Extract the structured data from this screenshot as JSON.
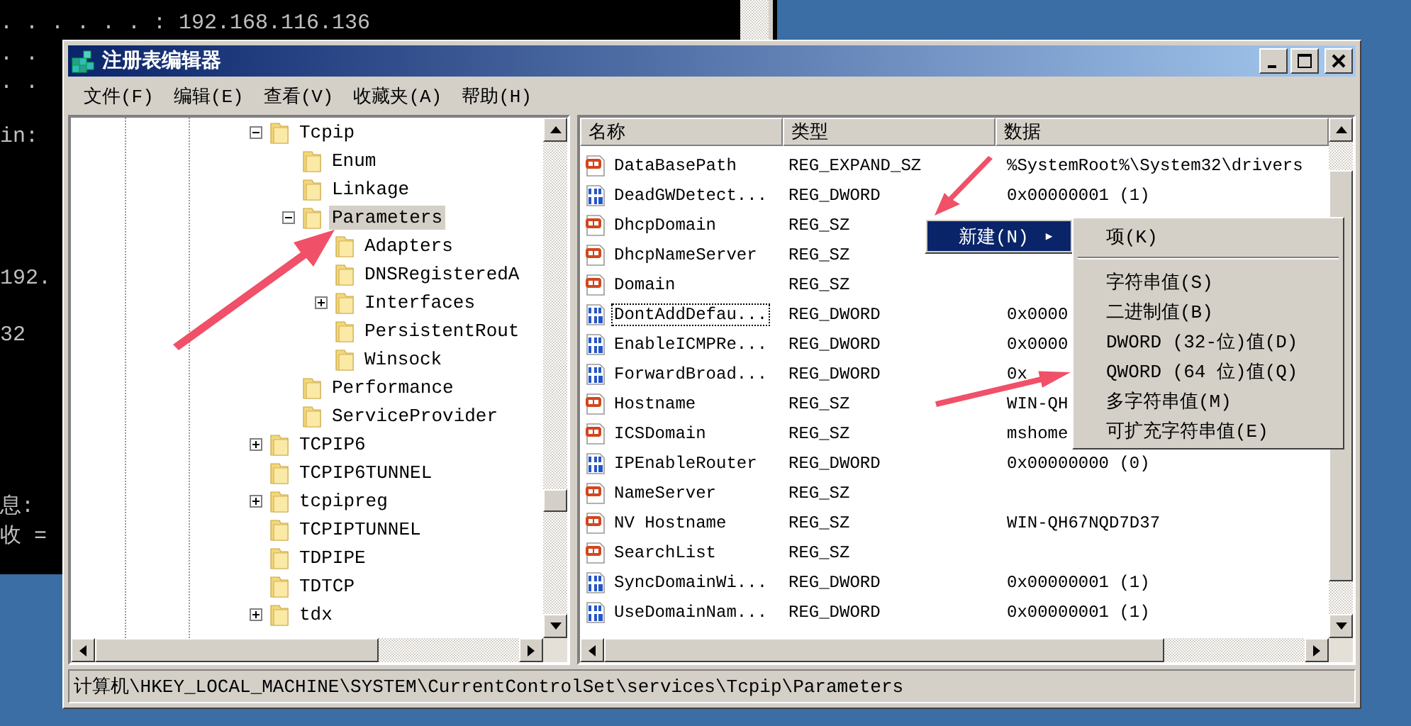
{
  "console": {
    "lines": [
      ". . . . . . : 192.168.116.136",
      ". .",
      ". .",
      "in:",
      "192.",
      "32",
      "息:",
      "收 ="
    ]
  },
  "window": {
    "title": "注册表编辑器"
  },
  "menu": [
    "文件(F)",
    "编辑(E)",
    "查看(V)",
    "收藏夹(A)",
    "帮助(H)"
  ],
  "tree": [
    {
      "label": "Tcpip",
      "expanded": true,
      "selected": false,
      "children": [
        {
          "label": "Enum",
          "selected": false
        },
        {
          "label": "Linkage",
          "selected": false
        },
        {
          "label": "Parameters",
          "expanded": true,
          "selected": true,
          "children": [
            {
              "label": "Adapters",
              "selected": false
            },
            {
              "label": "DNSRegisteredA",
              "selected": false
            },
            {
              "label": "Interfaces",
              "expanded": false,
              "selected": false
            },
            {
              "label": "PersistentRout",
              "selected": false
            },
            {
              "label": "Winsock",
              "selected": false
            }
          ]
        },
        {
          "label": "Performance",
          "selected": false
        },
        {
          "label": "ServiceProvider",
          "selected": false
        }
      ]
    },
    {
      "label": "TCPIP6",
      "expanded": false,
      "selected": false
    },
    {
      "label": "TCPIP6TUNNEL",
      "selected": false
    },
    {
      "label": "tcpipreg",
      "expanded": false,
      "selected": false
    },
    {
      "label": "TCPIPTUNNEL",
      "selected": false
    },
    {
      "label": "TDPIPE",
      "selected": false
    },
    {
      "label": "TDTCP",
      "selected": false
    },
    {
      "label": "tdx",
      "expanded": false,
      "selected": false
    }
  ],
  "list": {
    "columns": [
      "名称",
      "类型",
      "数据"
    ],
    "rows": [
      {
        "kind": "string",
        "name": "DataBasePath",
        "type": "REG_EXPAND_SZ",
        "data": "%SystemRoot%\\System32\\drivers",
        "focused": false
      },
      {
        "kind": "binary",
        "name": "DeadGWDetect...",
        "type": "REG_DWORD",
        "data": "0x00000001 (1)",
        "focused": false
      },
      {
        "kind": "string",
        "name": "DhcpDomain",
        "type": "REG_SZ",
        "focused": false
      },
      {
        "kind": "string",
        "name": "DhcpNameServer",
        "type": "REG_SZ",
        "focused": false
      },
      {
        "kind": "string",
        "name": "Domain",
        "type": "REG_SZ",
        "focused": false
      },
      {
        "kind": "binary",
        "name": "DontAddDefau...",
        "type": "REG_DWORD",
        "data": "0x0000",
        "focused": true
      },
      {
        "kind": "binary",
        "name": "EnableICMPRe...",
        "type": "REG_DWORD",
        "data": "0x0000",
        "focused": false
      },
      {
        "kind": "binary",
        "name": "ForwardBroad...",
        "type": "REG_DWORD",
        "data": "0x",
        "focused": false
      },
      {
        "kind": "string",
        "name": "Hostname",
        "type": "REG_SZ",
        "data": "WIN-QH",
        "focused": false
      },
      {
        "kind": "string",
        "name": "ICSDomain",
        "type": "REG_SZ",
        "data": "mshome",
        "focused": false
      },
      {
        "kind": "binary",
        "name": "IPEnableRouter",
        "type": "REG_DWORD",
        "data": "0x00000000 (0)",
        "focused": false
      },
      {
        "kind": "string",
        "name": "NameServer",
        "type": "REG_SZ",
        "focused": false
      },
      {
        "kind": "string",
        "name": "NV Hostname",
        "type": "REG_SZ",
        "data": "WIN-QH67NQD7D37",
        "focused": false
      },
      {
        "kind": "string",
        "name": "SearchList",
        "type": "REG_SZ",
        "focused": false
      },
      {
        "kind": "binary",
        "name": "SyncDomainWi...",
        "type": "REG_DWORD",
        "data": "0x00000001 (1)",
        "focused": false
      },
      {
        "kind": "binary",
        "name": "UseDomainNam...",
        "type": "REG_DWORD",
        "data": "0x00000001 (1)",
        "focused": false
      }
    ]
  },
  "context_menu": {
    "label": "新建(N)",
    "arrow": "▶",
    "selected": true,
    "submenu": [
      {
        "kind": "item",
        "label": "项(K)"
      },
      {
        "kind": "separator"
      },
      {
        "kind": "item",
        "label": "字符串值(S)"
      },
      {
        "kind": "item",
        "label": "二进制值(B)"
      },
      {
        "kind": "item",
        "label": "DWORD (32-位)值(D)"
      },
      {
        "kind": "item",
        "label": "QWORD (64 位)值(Q)"
      },
      {
        "kind": "item",
        "label": "多字符串值(M)"
      },
      {
        "kind": "item",
        "label": "可扩充字符串值(E)"
      }
    ]
  },
  "status_bar": "计算机\\HKEY_LOCAL_MACHINE\\SYSTEM\\CurrentControlSet\\services\\Tcpip\\Parameters"
}
